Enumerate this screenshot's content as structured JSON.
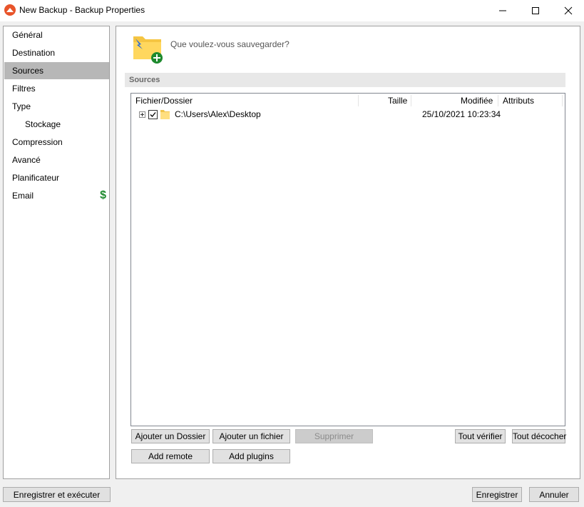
{
  "window": {
    "title": "New Backup - Backup Properties",
    "accent": "#e8542a"
  },
  "nav": {
    "items": [
      {
        "label": "Général"
      },
      {
        "label": "Destination"
      },
      {
        "label": "Sources",
        "selected": true
      },
      {
        "label": "Filtres"
      },
      {
        "label": "Type"
      },
      {
        "label": "Stockage",
        "sub": true
      },
      {
        "label": "Compression"
      },
      {
        "label": "Avancé"
      },
      {
        "label": "Planificateur"
      },
      {
        "label": "Email",
        "badge_icon": "dollar-icon",
        "badge_text": "$"
      }
    ]
  },
  "content": {
    "header_icon": "folder-add-icon",
    "header_text": "Que voulez-vous sauvegarder?",
    "section_title": "Sources",
    "columns": [
      "Fichier/Dossier",
      "Taille",
      "Modifiée",
      "Attributs"
    ],
    "rows": [
      {
        "path": "C:\\Users\\Alex\\Desktop",
        "size": "",
        "modified": "25/10/2021 10:23:34",
        "attributes": "",
        "checked": true
      }
    ],
    "buttons": {
      "add_folder": "Ajouter un Dossier",
      "add_file": "Ajouter un fichier",
      "delete": "Supprimer",
      "check_all": "Tout vérifier",
      "uncheck_all": "Tout décocher",
      "add_remote": "Add remote",
      "add_plugins": "Add plugins"
    }
  },
  "footer": {
    "save_run": "Enregistrer et exécuter",
    "save": "Enregistrer",
    "cancel": "Annuler"
  }
}
